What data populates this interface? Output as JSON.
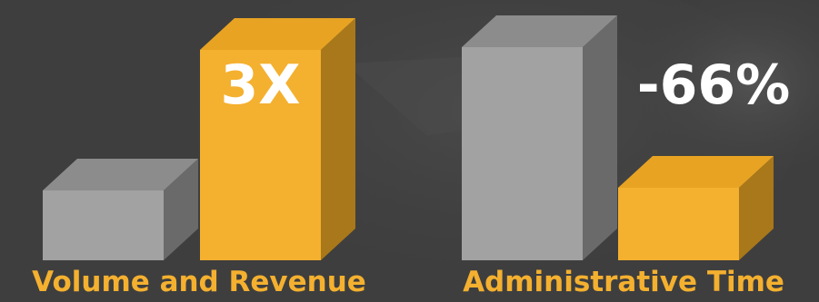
{
  "colors": {
    "background": "#3e3e3e",
    "highlight": "#f4b02f",
    "label_text": "#ffffff"
  },
  "chart_data": [
    {
      "type": "bar",
      "title": "",
      "categories": [
        "",
        ""
      ],
      "series": [
        {
          "values": [
            1,
            3
          ]
        }
      ],
      "data_labels": [
        "",
        "3X"
      ],
      "bar_colors": [
        "#9e9e9e",
        "#f4b02f"
      ],
      "label": "Volume and Revenue",
      "ylim": [
        0,
        3.2
      ]
    },
    {
      "type": "bar",
      "title": "",
      "categories": [
        "",
        ""
      ],
      "series": [
        {
          "values": [
            100,
            34
          ]
        }
      ],
      "data_labels": [
        "",
        "-66%"
      ],
      "bar_colors": [
        "#9e9e9e",
        "#f4b02f"
      ],
      "label": "Administrative Time",
      "ylim": [
        0,
        105
      ]
    }
  ]
}
